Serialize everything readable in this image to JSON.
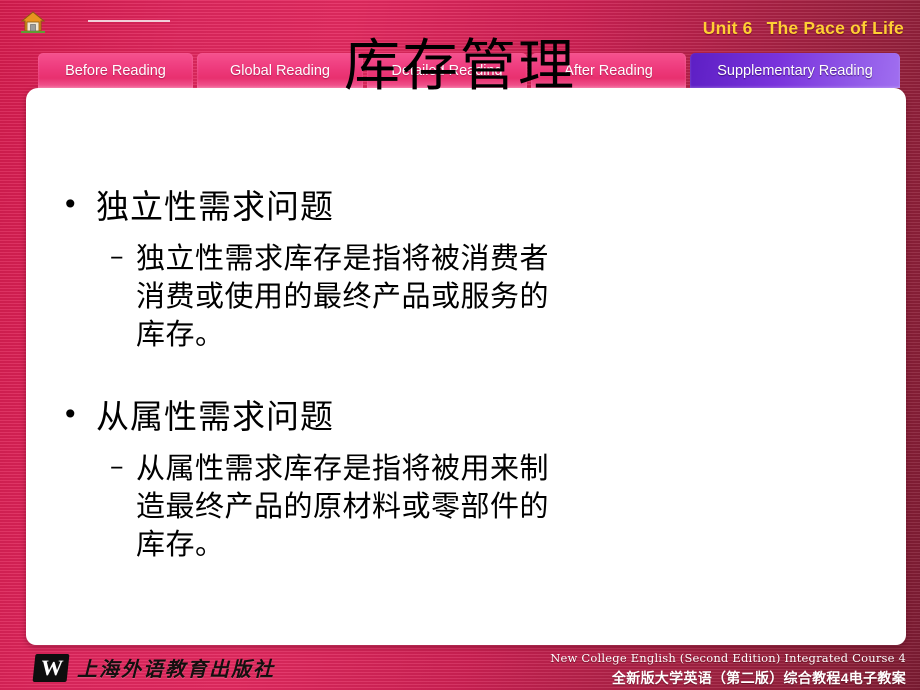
{
  "header": {
    "home_icon": "home-icon",
    "unit_number": "Unit 6",
    "unit_name": "The Pace of Life"
  },
  "tabs": [
    {
      "label": "Before Reading",
      "active": false
    },
    {
      "label": "Global Reading",
      "active": false
    },
    {
      "label": "Detailed Reading",
      "active": false
    },
    {
      "label": "After Reading",
      "active": false
    },
    {
      "label": "Supplementary Reading",
      "active": true
    }
  ],
  "slide": {
    "title": "库存管理",
    "blocks": [
      {
        "bullet": "•",
        "heading": "独立性需求问题",
        "dash": "–",
        "detail": "独立性需求库存是指将被消费者消费或使用的最终产品或服务的库存。"
      },
      {
        "bullet": "•",
        "heading": "从属性需求问题",
        "dash": "–",
        "detail": "从属性需求库存是指将被用来制造最终产品的原材料或零部件的库存。"
      }
    ]
  },
  "footer": {
    "logo_mark": "W",
    "logo_text": "上海外语教育出版社",
    "line_en": "New College English (Second Edition) Integrated Course 4",
    "line_cn": "全新版大学英语（第二版）综合教程4电子教案"
  },
  "colors": {
    "background_red": "#d61c4e",
    "tab_pink": "#ef3d7f",
    "tab_active_purple": "#7a33dc",
    "unit_title_gold": "#ffcf33",
    "panel_white": "#ffffff"
  }
}
